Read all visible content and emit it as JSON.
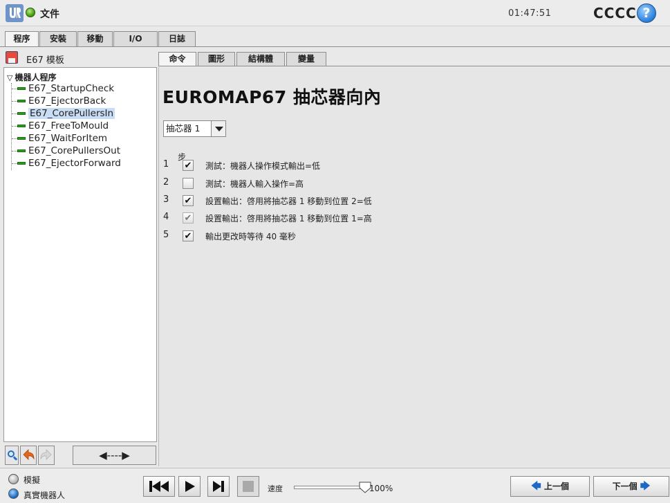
{
  "app": {
    "file_label": "文件",
    "clock": "01:47:51",
    "robot_name": "CCCC",
    "help_symbol": "?"
  },
  "main_tabs": [
    {
      "label": "程序",
      "active": true
    },
    {
      "label": "安裝",
      "active": false
    },
    {
      "label": "移動",
      "active": false
    },
    {
      "label": "I/O",
      "active": false
    },
    {
      "label": "日誌",
      "active": false
    }
  ],
  "left_panel": {
    "template_title": "E67 模板",
    "tree_root": "機器人程序",
    "tree_items": [
      "E67_StartupCheck",
      "E67_EjectorBack",
      "E67_CorePullersIn",
      "E67_FreeToMould",
      "E67_WaitForItem",
      "E67_CorePullersOut",
      "E67_EjectorForward"
    ],
    "selected_item": "E67_CorePullersIn",
    "move_button": "◀----▶"
  },
  "sub_tabs": [
    {
      "label": "命令",
      "active": true
    },
    {
      "label": "圖形",
      "active": false
    },
    {
      "label": "結構體",
      "active": false
    },
    {
      "label": "變量",
      "active": false
    }
  ],
  "content": {
    "title": "EUROMAP67 抽芯器向內",
    "puller_select": "抽芯器 1",
    "step_header": "步",
    "steps": [
      {
        "num": "1",
        "checked": true,
        "dim": false,
        "text": "測試：機器人操作模式輸出=低"
      },
      {
        "num": "2",
        "checked": false,
        "dim": false,
        "text": "測試：機器人輸入操作=高"
      },
      {
        "num": "3",
        "checked": true,
        "dim": false,
        "text": "設置輸出：啓用將抽芯器 1 移動到位置 2=低"
      },
      {
        "num": "4",
        "checked": true,
        "dim": true,
        "text": "設置輸出：啓用將抽芯器 1 移動到位置 1=高"
      },
      {
        "num": "5",
        "checked": true,
        "dim": false,
        "text": "輸出更改時等待 40 毫秒"
      }
    ]
  },
  "bottom": {
    "sim_label": "模擬",
    "real_label": "真實機器人",
    "speed_label": "速度",
    "speed_value": "100%",
    "speed_fraction": 1.0,
    "prev_label": "上一個",
    "next_label": "下一個"
  },
  "colors": {
    "accent_blue": "#1d68c5",
    "tree_bar_green": "#2a9b1c",
    "selection": "#c9ddf4"
  }
}
